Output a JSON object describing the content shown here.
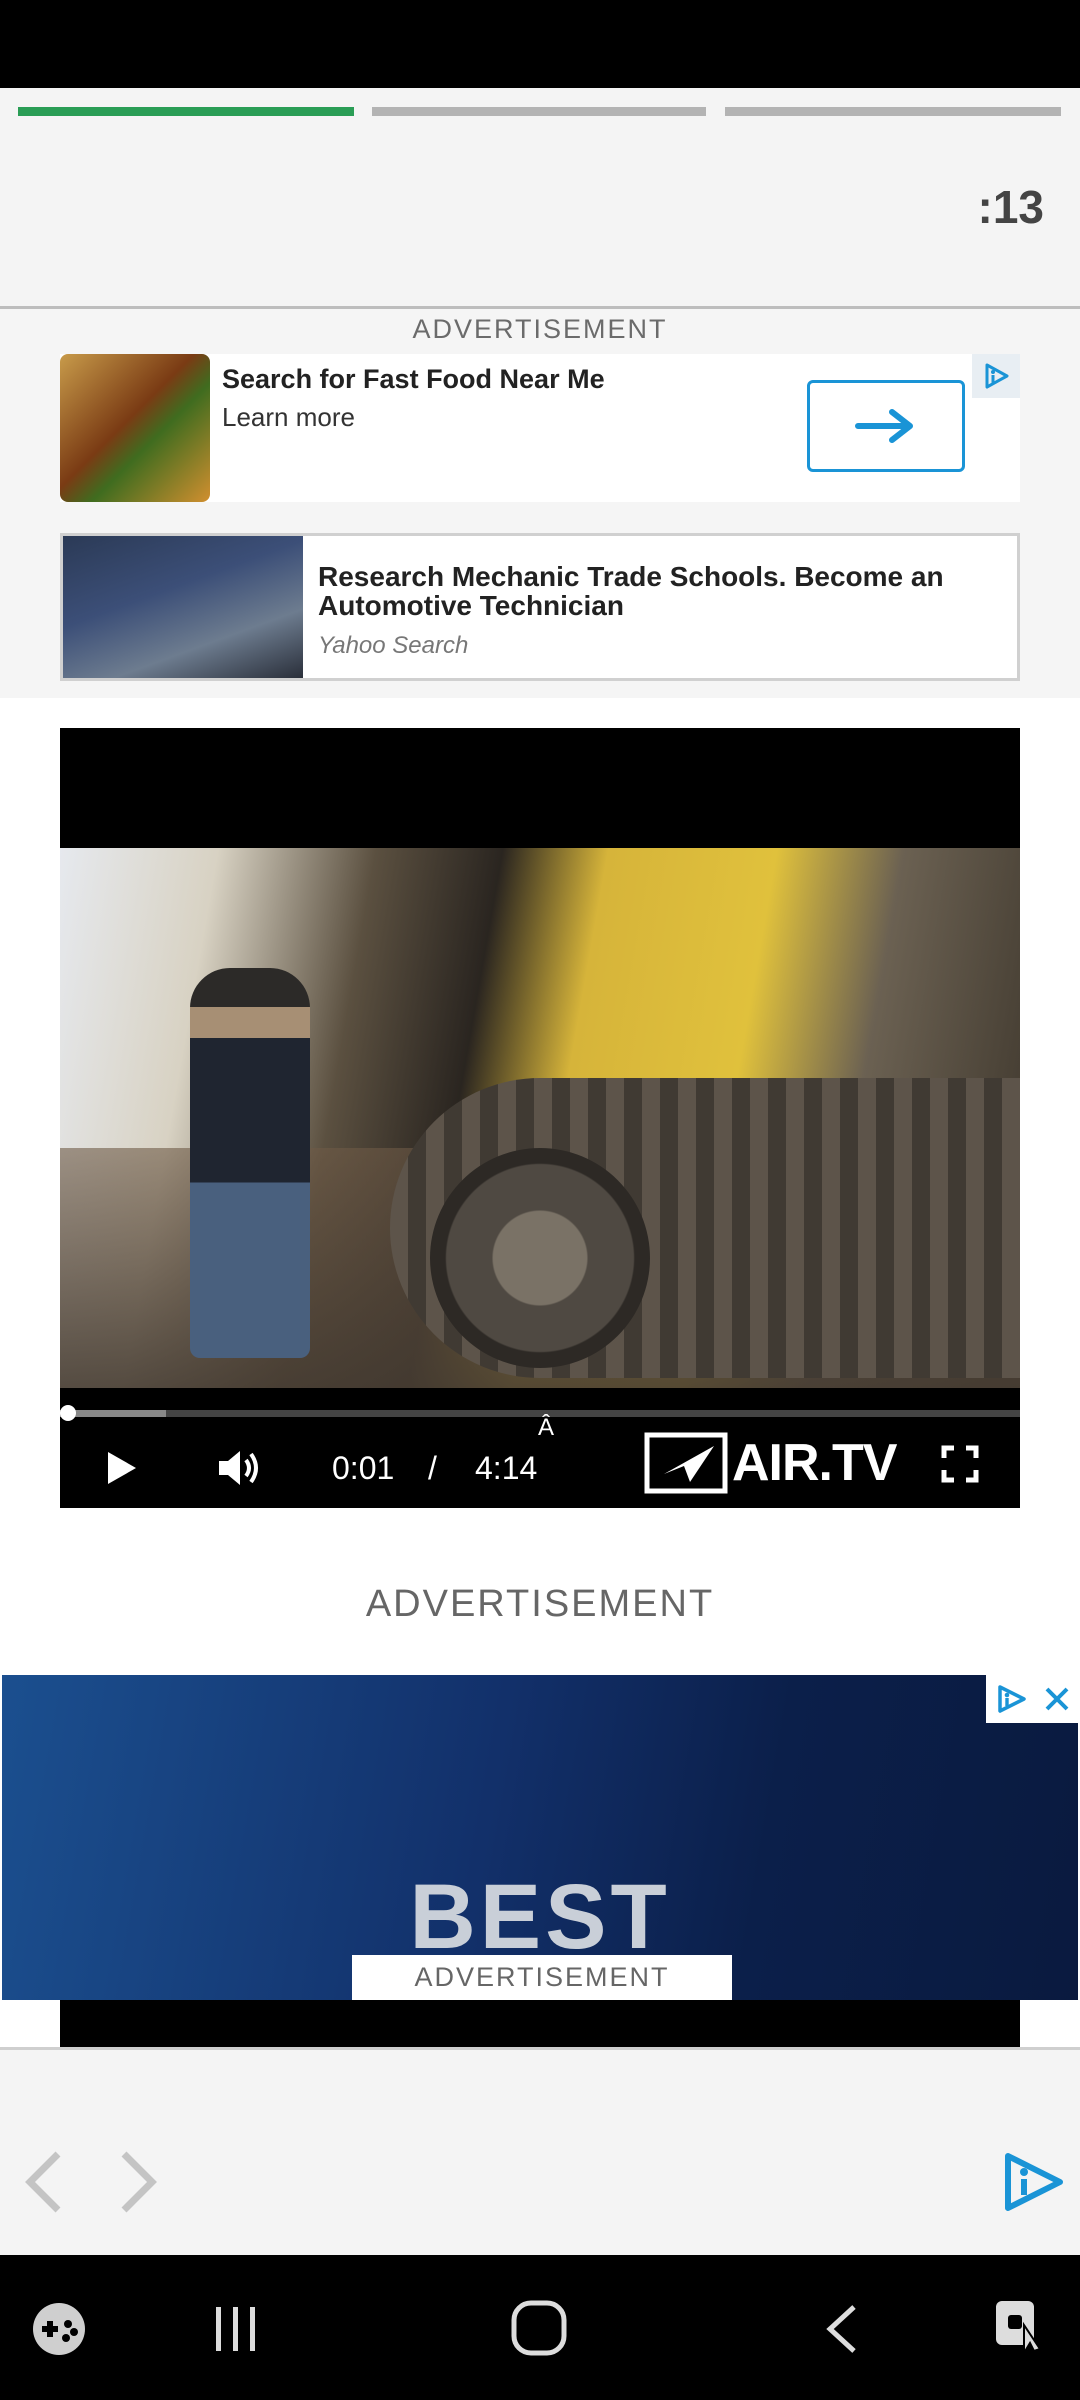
{
  "progress": {
    "segments": 3,
    "active_index": 0,
    "active_color": "#2a9d55"
  },
  "timer": ":13",
  "ad_top": {
    "label": "ADVERTISEMENT",
    "card1": {
      "title": "Search for Fast Food Near Me",
      "subtitle": "Learn more",
      "cta_icon": "arrow-right-icon",
      "badge_icon": "adchoices-icon"
    },
    "card2": {
      "title": "Research Mechanic Trade Schools. Become an Automotive Technician",
      "source": "Yahoo Search"
    }
  },
  "video": {
    "current_time": "0:01",
    "separator": "/",
    "duration": "4:14",
    "stray_char": "Â",
    "brand": "AIR.TV",
    "progress_fraction": 0.004,
    "buffer_fraction": 0.11,
    "controls": [
      "play-icon",
      "volume-icon",
      "fullscreen-icon"
    ]
  },
  "ad_mid": {
    "label": "ADVERTISEMENT"
  },
  "ad_banner": {
    "headline": "BEST",
    "footer_label": "ADVERTISEMENT",
    "badge_icons": [
      "adchoices-icon",
      "close-icon"
    ]
  },
  "bottom": {
    "prev_icon": "chevron-left-icon",
    "next_icon": "chevron-right-icon",
    "brand_icon": "ad-info-icon"
  },
  "nav": [
    "game-launcher-icon",
    "recent-apps-icon",
    "home-icon",
    "back-icon",
    "accessibility-icon"
  ],
  "colors": {
    "accent_blue": "#1a94d6",
    "green": "#2a9d55"
  }
}
